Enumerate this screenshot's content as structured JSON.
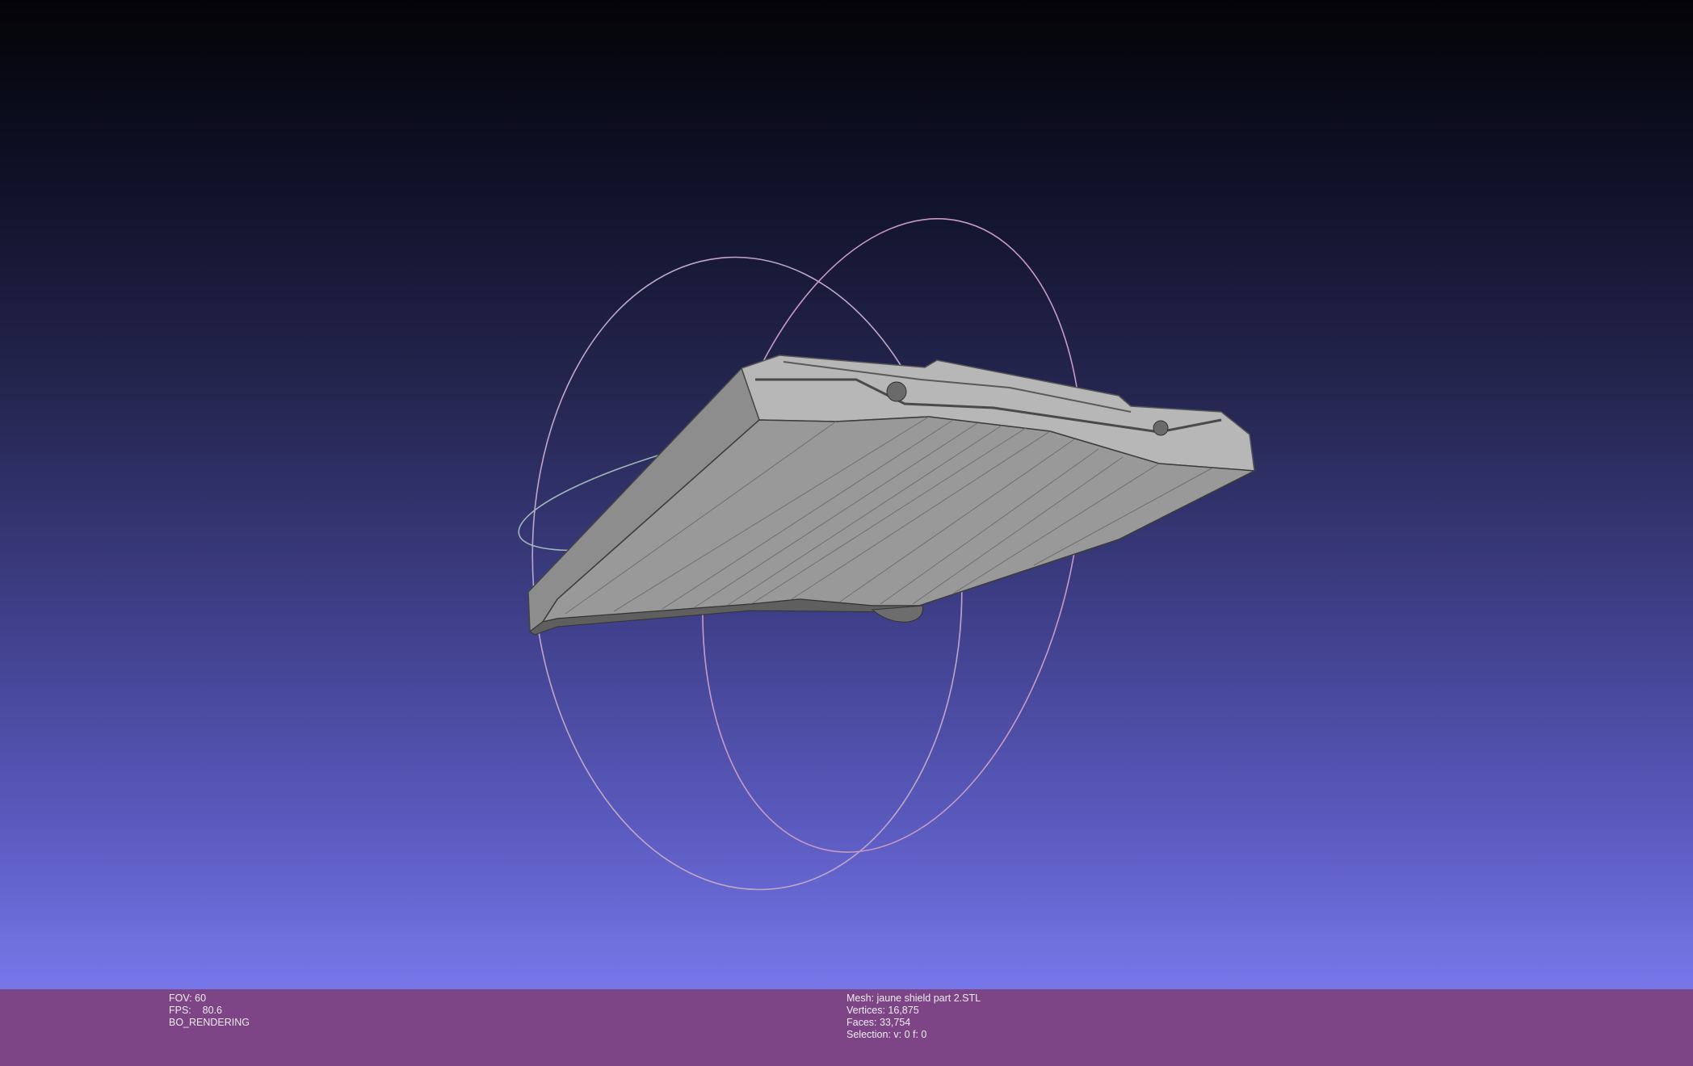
{
  "viewport": {
    "background_top": "#030307",
    "background_bottom": "#7a7aee",
    "mesh_color": "#9a9a9a",
    "trackball_colors": [
      "#c8a0c8",
      "#a0c8a0",
      "#a0a0d0"
    ]
  },
  "info_bar": {
    "background": "#7d4585",
    "left": {
      "fov": "FOV: 60",
      "fps": "FPS:    80.6",
      "mode": "BO_RENDERING"
    },
    "right": {
      "mesh": "Mesh: jaune shield part 2.STL",
      "vertices": "Vertices: 16,875",
      "faces": "Faces: 33,754",
      "selection": "Selection: v: 0 f: 0"
    }
  }
}
